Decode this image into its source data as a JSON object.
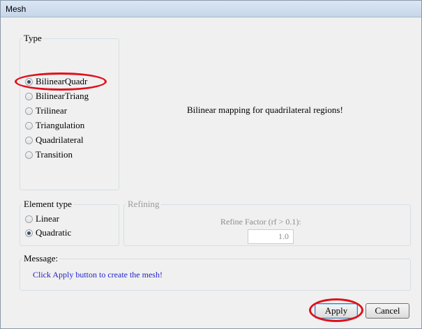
{
  "window": {
    "title": "Mesh"
  },
  "type_group": {
    "legend": "Type",
    "options": [
      {
        "label": "BilinearQuadr",
        "checked": true
      },
      {
        "label": "BilinearTriang",
        "checked": false
      },
      {
        "label": "Trilinear",
        "checked": false
      },
      {
        "label": "Triangulation",
        "checked": false
      },
      {
        "label": "Quadrilateral",
        "checked": false
      },
      {
        "label": "Transition",
        "checked": false
      }
    ]
  },
  "description": "Bilinear mapping for quadrilateral regions!",
  "element_type_group": {
    "legend": "Element type",
    "options": [
      {
        "label": "Linear",
        "checked": false
      },
      {
        "label": "Quadratic",
        "checked": true
      }
    ]
  },
  "refining_group": {
    "legend": "Refining",
    "refine_factor_label": "Refine Factor (rf > 0.1):",
    "refine_factor_value": "1.0"
  },
  "message_group": {
    "legend": "Message:",
    "text": "Click Apply button to create the mesh!"
  },
  "buttons": {
    "apply": "Apply",
    "cancel": "Cancel"
  },
  "colors": {
    "annotation": "#e0101a",
    "message_text": "#1f1fcc"
  }
}
